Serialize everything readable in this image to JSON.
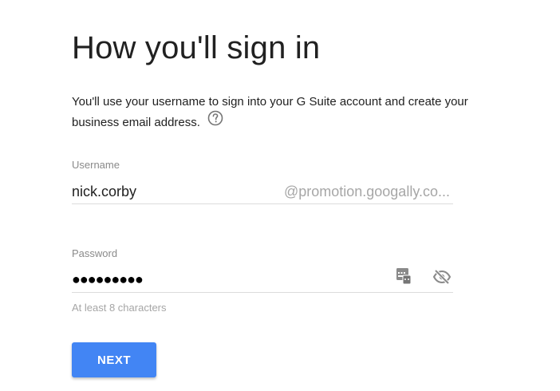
{
  "header": {
    "title": "How you'll sign in"
  },
  "description": {
    "text": "You'll use your username to sign into your G Suite account and create your business email address.",
    "help_icon": "question-circle-icon"
  },
  "username": {
    "label": "Username",
    "value": "nick.corby",
    "domain_suffix": "@promotion.googally.co..."
  },
  "password": {
    "label": "Password",
    "value_masked": "●●●●●●●●●",
    "hint": "At least 8 characters",
    "keyboard_icon": "password-keyboard-icon",
    "visibility_icon": "eye-slash-icon"
  },
  "actions": {
    "next_label": "NEXT"
  },
  "colors": {
    "accent": "#4285f4",
    "text": "#212121",
    "muted": "#8a8a8a",
    "divider": "#dcdcdc"
  }
}
